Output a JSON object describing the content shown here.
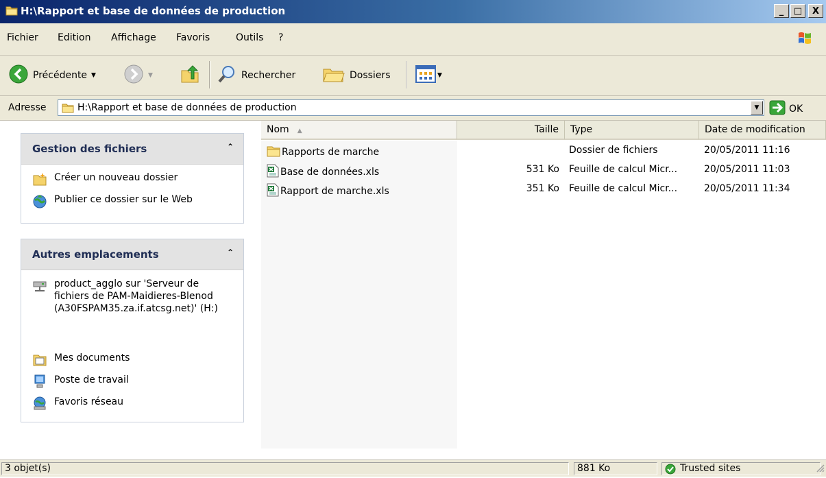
{
  "window": {
    "title": "H:\\Rapport et base de données de production",
    "controls": {
      "minimize": "_",
      "maximize": "□",
      "close": "X"
    }
  },
  "menubar": {
    "items": [
      "Fichier",
      "Edition",
      "Affichage",
      "Favoris",
      "Outils",
      "?"
    ]
  },
  "toolbar": {
    "back_label": "Précédente",
    "search_label": "Rechercher",
    "folders_label": "Dossiers"
  },
  "address": {
    "label": "Adresse",
    "value": "H:\\Rapport et base de données de production",
    "go_label": "OK"
  },
  "tasks_panel": {
    "title": "Gestion des fichiers",
    "items": [
      {
        "label": "Créer un nouveau dossier",
        "icon": "new-folder-icon"
      },
      {
        "label": "Publier ce dossier sur le Web",
        "icon": "publish-web-icon"
      }
    ]
  },
  "places_panel": {
    "title": "Autres emplacements",
    "items": [
      {
        "label": "product_agglo sur 'Serveur de fichiers de PAM-Maidieres-Blenod (A30FSPAM35.za.if.atcsg.net)' (H:)",
        "icon": "network-drive-icon"
      },
      {
        "label": "Mes documents",
        "icon": "my-documents-icon"
      },
      {
        "label": "Poste de travail",
        "icon": "my-computer-icon"
      },
      {
        "label": "Favoris réseau",
        "icon": "network-places-icon"
      }
    ]
  },
  "file_list": {
    "columns": [
      "Nom",
      "Taille",
      "Type",
      "Date de modification"
    ],
    "rows": [
      {
        "name": "Rapports de marche",
        "size": "",
        "type": "Dossier de fichiers",
        "date": "20/05/2011 11:16",
        "icon": "folder-icon"
      },
      {
        "name": "Base de données.xls",
        "size": "531 Ko",
        "type": "Feuille de calcul Micr...",
        "date": "20/05/2011 11:03",
        "icon": "excel-file-icon"
      },
      {
        "name": "Rapport de marche.xls",
        "size": "351 Ko",
        "type": "Feuille de calcul Micr...",
        "date": "20/05/2011 11:34",
        "icon": "excel-file-icon"
      }
    ]
  },
  "statusbar": {
    "objects": "3 objet(s)",
    "size": "881 Ko",
    "zone": "Trusted sites"
  },
  "colors": {
    "title_gradient_start": "#0a246a",
    "title_gradient_end": "#a6caf0",
    "chrome_background": "#ece9d8",
    "panel_header": "#e3e3e3",
    "panel_title_text": "#1f2d54"
  }
}
